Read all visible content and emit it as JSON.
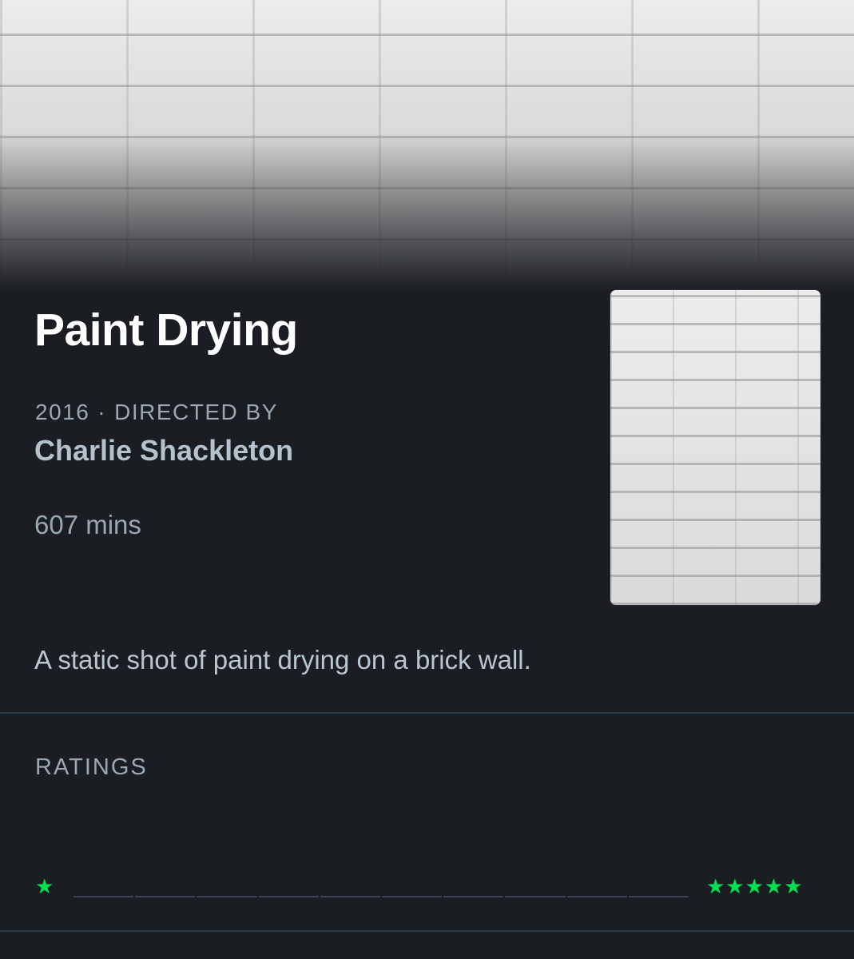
{
  "film": {
    "title": "Paint Drying",
    "year": "2016",
    "separator": "·",
    "directed_by_label": "DIRECTED BY",
    "director": "Charlie Shackleton",
    "runtime": "607 mins",
    "tagline": "A static shot of paint drying on a brick wall."
  },
  "ratings": {
    "label": "RATINGS",
    "low_star": "★",
    "high_stars": "★★★★★",
    "histogram_bars": 10,
    "accent_color": "#00e054"
  },
  "colors": {
    "background": "#1a1d21",
    "title": "#ffffff",
    "muted_text": "#9aa8b4",
    "divider": "#2d3b48"
  }
}
